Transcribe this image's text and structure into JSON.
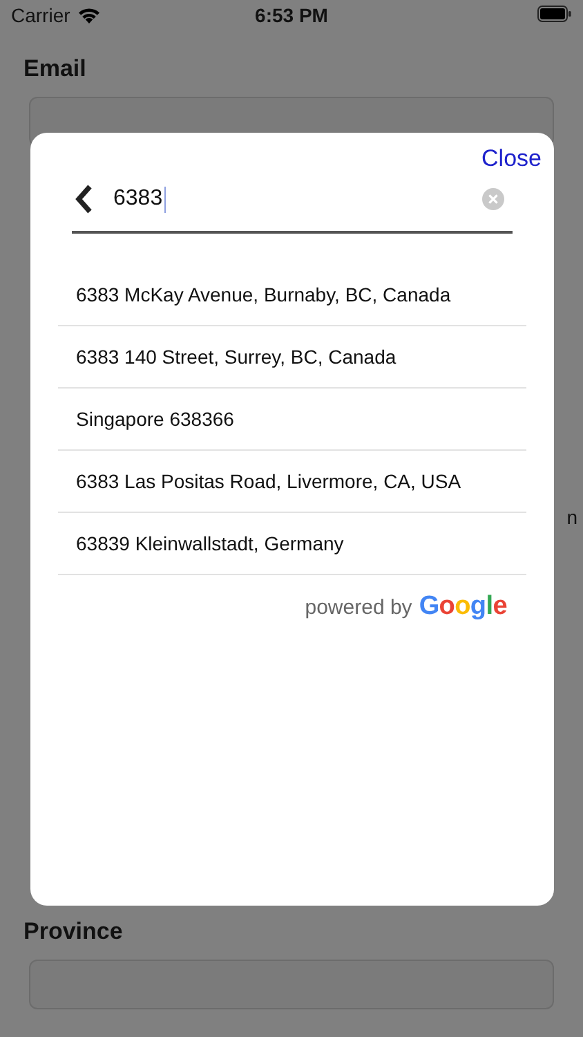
{
  "status_bar": {
    "carrier": "Carrier",
    "time": "6:53 PM"
  },
  "form": {
    "fields": [
      {
        "label": "Email"
      },
      {
        "label": "Province"
      }
    ],
    "stray_text": "n"
  },
  "dialog": {
    "close": "Close",
    "search": {
      "value": "6383"
    },
    "results": [
      "6383 McKay Avenue, Burnaby, BC, Canada",
      "6383 140 Street, Surrey, BC, Canada",
      "Singapore 638366",
      "6383 Las Positas Road, Livermore, CA, USA",
      "63839 Kleinwallstadt, Germany"
    ],
    "attribution": {
      "prefix": "powered by",
      "logo": "Google",
      "letters": [
        {
          "color": "#4285f4"
        },
        {
          "color": "#ea4335"
        },
        {
          "color": "#fbbc05"
        },
        {
          "color": "#4285f4"
        },
        {
          "color": "#34a853"
        },
        {
          "color": "#ea4335"
        }
      ]
    }
  }
}
